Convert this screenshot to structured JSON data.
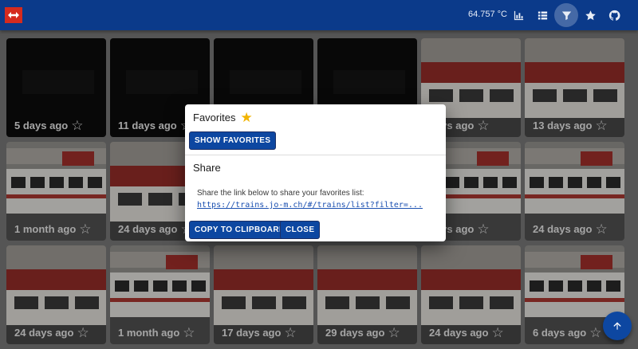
{
  "appbar": {
    "temperature": "64.757 °C",
    "buttons": [
      {
        "name": "stats-button",
        "icon": "bar-chart-icon"
      },
      {
        "name": "list-view-button",
        "icon": "list-icon"
      },
      {
        "name": "filter-button",
        "icon": "filter-icon",
        "active": true
      },
      {
        "name": "favorites-button",
        "icon": "star-icon"
      },
      {
        "name": "github-button",
        "icon": "github-icon"
      }
    ]
  },
  "tiles": [
    {
      "label": "5 days ago",
      "art": "dark"
    },
    {
      "label": "11 days ago",
      "art": "dark"
    },
    {
      "label": "",
      "art": "dark"
    },
    {
      "label": "",
      "art": "dark"
    },
    {
      "label": "days ago",
      "art": "train-front"
    },
    {
      "label": "13 days ago",
      "art": "train-front"
    },
    {
      "label": "1 month ago",
      "art": "train-side"
    },
    {
      "label": "24 days ago",
      "art": "train-front"
    },
    {
      "label": "",
      "art": "train-side"
    },
    {
      "label": "",
      "art": "train-side"
    },
    {
      "label": "days ago",
      "art": "train-side"
    },
    {
      "label": "24 days ago",
      "art": "train-side"
    },
    {
      "label": "24 days ago",
      "art": "train-front"
    },
    {
      "label": "1 month ago",
      "art": "train-side"
    },
    {
      "label": "17 days ago",
      "art": "train-front"
    },
    {
      "label": "29 days ago",
      "art": "train-front"
    },
    {
      "label": "24 days ago",
      "art": "train-front"
    },
    {
      "label": "6 days ago",
      "art": "train-side"
    }
  ],
  "dialog": {
    "favorites_title": "Favorites",
    "show_favorites": "SHOW FAVORITES",
    "share_title": "Share",
    "share_text": "Share the link below to share your favorites list:",
    "share_link": "https://trains.jo-m.ch/#/trains/list?filter=...",
    "copy_button": "COPY TO CLIPBOARD",
    "close_button": "CLOSE"
  },
  "fab": {
    "icon": "arrow-up-icon"
  },
  "colors": {
    "appbar": "#0b3a8a",
    "button": "#0d47a1",
    "favorite_star": "#f2b400"
  }
}
